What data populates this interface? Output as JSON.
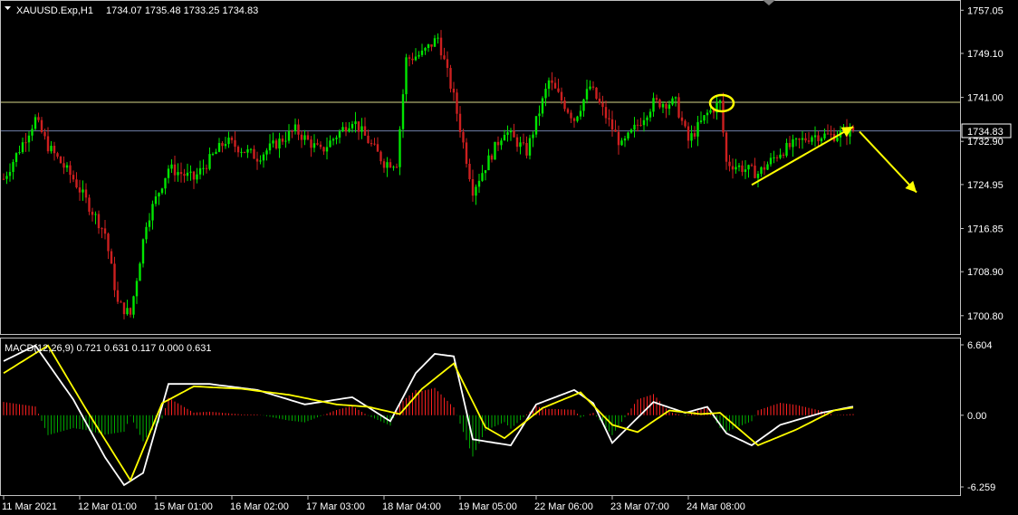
{
  "chart_data": [
    {
      "type": "candlestick",
      "symbol_header": "XAUUSD.Exp,H1",
      "ohlc_header": "1734.07 1735.48 1733.25 1734.83",
      "current_price_label": "1734.83",
      "ylim": [
        1697.6,
        1758.6
      ],
      "y_ticks": [
        "1757.05",
        "1749.10",
        "1741.00",
        "1732.90",
        "1724.95",
        "1716.85",
        "1708.90",
        "1700.80"
      ],
      "horizontal_lines": [
        {
          "value": 1740.1,
          "color": "#d6d68a"
        },
        {
          "value": 1734.83,
          "color": "#6f7fa8"
        }
      ],
      "colors": {
        "bull": "#00e600",
        "bear": "#cc1f1f",
        "background": "#000000",
        "annotation": "#ffff00"
      },
      "annotations": [
        {
          "type": "ellipse",
          "bar_index": 226,
          "price": 1740.1
        },
        {
          "type": "arrow",
          "from": {
            "bar_index": 236,
            "price": 1724.9
          },
          "to": {
            "bar_index": 268,
            "price": 1735.6
          }
        },
        {
          "type": "arrow",
          "from": {
            "bar_index": 270,
            "price": 1734.7
          },
          "to": {
            "bar_index": 288,
            "price": 1723.5
          }
        }
      ],
      "anchors": [
        {
          "bar": 0,
          "price": 1726
        },
        {
          "bar": 10,
          "price": 1737
        },
        {
          "bar": 14,
          "price": 1732
        },
        {
          "bar": 22,
          "price": 1726
        },
        {
          "bar": 32,
          "price": 1716
        },
        {
          "bar": 36,
          "price": 1703
        },
        {
          "bar": 40,
          "price": 1701
        },
        {
          "bar": 45,
          "price": 1718
        },
        {
          "bar": 52,
          "price": 1728
        },
        {
          "bar": 60,
          "price": 1726
        },
        {
          "bar": 70,
          "price": 1733
        },
        {
          "bar": 80,
          "price": 1730
        },
        {
          "bar": 92,
          "price": 1735
        },
        {
          "bar": 100,
          "price": 1731
        },
        {
          "bar": 110,
          "price": 1737
        },
        {
          "bar": 120,
          "price": 1729
        },
        {
          "bar": 124,
          "price": 1729
        },
        {
          "bar": 127,
          "price": 1748
        },
        {
          "bar": 132,
          "price": 1749
        },
        {
          "bar": 137,
          "price": 1752
        },
        {
          "bar": 142,
          "price": 1741
        },
        {
          "bar": 148,
          "price": 1724
        },
        {
          "bar": 158,
          "price": 1735
        },
        {
          "bar": 165,
          "price": 1731
        },
        {
          "bar": 172,
          "price": 1744
        },
        {
          "bar": 180,
          "price": 1737
        },
        {
          "bar": 185,
          "price": 1743
        },
        {
          "bar": 195,
          "price": 1732
        },
        {
          "bar": 205,
          "price": 1740
        },
        {
          "bar": 212,
          "price": 1740
        },
        {
          "bar": 216,
          "price": 1733
        },
        {
          "bar": 222,
          "price": 1738
        },
        {
          "bar": 226,
          "price": 1740
        },
        {
          "bar": 228,
          "price": 1729
        },
        {
          "bar": 238,
          "price": 1727
        },
        {
          "bar": 245,
          "price": 1731
        },
        {
          "bar": 255,
          "price": 1734
        },
        {
          "bar": 262,
          "price": 1734
        },
        {
          "bar": 268,
          "price": 1735
        }
      ]
    },
    {
      "type": "macd",
      "header": "MACD(12,26,9) 0.721 0.631 0.117 0.000 0.631",
      "ylim": [
        -6.259,
        6.604
      ],
      "y_ticks": [
        "6.604",
        "0.00",
        "-6.259"
      ],
      "colors": {
        "macd_line": "#ffffff",
        "signal_line": "#ffff00",
        "hist_pos": "#ff2020",
        "hist_neg": "#00aa00"
      },
      "macd_anchors": [
        {
          "bar": 0,
          "value": 4.5
        },
        {
          "bar": 10,
          "value": 5.8
        },
        {
          "bar": 22,
          "value": 1.3
        },
        {
          "bar": 32,
          "value": -3.5
        },
        {
          "bar": 38,
          "value": -5.8
        },
        {
          "bar": 44,
          "value": -4.8
        },
        {
          "bar": 52,
          "value": 2.6
        },
        {
          "bar": 65,
          "value": 2.6
        },
        {
          "bar": 80,
          "value": 2.1
        },
        {
          "bar": 95,
          "value": 0.9
        },
        {
          "bar": 110,
          "value": 1.5
        },
        {
          "bar": 122,
          "value": -0.5
        },
        {
          "bar": 130,
          "value": 3.5
        },
        {
          "bar": 136,
          "value": 5.1
        },
        {
          "bar": 142,
          "value": 4.9
        },
        {
          "bar": 148,
          "value": -2.0
        },
        {
          "bar": 160,
          "value": -2.5
        },
        {
          "bar": 168,
          "value": 0.9
        },
        {
          "bar": 180,
          "value": 2.1
        },
        {
          "bar": 186,
          "value": 1.0
        },
        {
          "bar": 192,
          "value": -2.3
        },
        {
          "bar": 205,
          "value": 1.1
        },
        {
          "bar": 215,
          "value": 0.2
        },
        {
          "bar": 222,
          "value": 0.7
        },
        {
          "bar": 228,
          "value": -1.5
        },
        {
          "bar": 236,
          "value": -2.5
        },
        {
          "bar": 245,
          "value": -0.8
        },
        {
          "bar": 258,
          "value": 0.2
        },
        {
          "bar": 268,
          "value": 0.72
        }
      ],
      "signal_anchors": [
        {
          "bar": 0,
          "value": 3.5
        },
        {
          "bar": 14,
          "value": 5.8
        },
        {
          "bar": 26,
          "value": 0.5
        },
        {
          "bar": 40,
          "value": -5.4
        },
        {
          "bar": 50,
          "value": 1.0
        },
        {
          "bar": 60,
          "value": 2.4
        },
        {
          "bar": 75,
          "value": 2.2
        },
        {
          "bar": 90,
          "value": 1.7
        },
        {
          "bar": 105,
          "value": 0.9
        },
        {
          "bar": 115,
          "value": 0.7
        },
        {
          "bar": 125,
          "value": 0.1
        },
        {
          "bar": 132,
          "value": 2.2
        },
        {
          "bar": 142,
          "value": 4.3
        },
        {
          "bar": 152,
          "value": -1.0
        },
        {
          "bar": 158,
          "value": -1.9
        },
        {
          "bar": 170,
          "value": 0.6
        },
        {
          "bar": 182,
          "value": 1.9
        },
        {
          "bar": 192,
          "value": -0.8
        },
        {
          "bar": 200,
          "value": -1.4
        },
        {
          "bar": 210,
          "value": 0.4
        },
        {
          "bar": 220,
          "value": 0.1
        },
        {
          "bar": 226,
          "value": 0.2
        },
        {
          "bar": 238,
          "value": -2.5
        },
        {
          "bar": 250,
          "value": -1.2
        },
        {
          "bar": 262,
          "value": 0.4
        },
        {
          "bar": 268,
          "value": 0.63
        }
      ]
    }
  ],
  "x_axis_labels": [
    {
      "text": "11 Mar 2021",
      "bar": 0
    },
    {
      "text": "12 Mar 01:00",
      "bar": 24
    },
    {
      "text": "15 Mar 01:00",
      "bar": 48
    },
    {
      "text": "16 Mar 02:00",
      "bar": 72
    },
    {
      "text": "17 Mar 03:00",
      "bar": 96
    },
    {
      "text": "18 Mar 04:00",
      "bar": 120
    },
    {
      "text": "19 Mar 05:00",
      "bar": 144
    },
    {
      "text": "22 Mar 06:00",
      "bar": 168
    },
    {
      "text": "23 Mar 07:00",
      "bar": 192
    },
    {
      "text": "24 Mar 08:00",
      "bar": 216
    }
  ],
  "total_bars": 269
}
